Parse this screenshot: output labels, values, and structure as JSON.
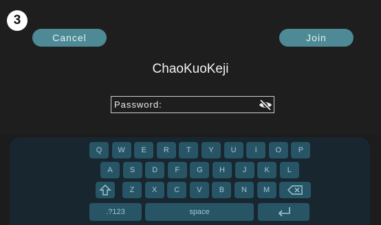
{
  "step": {
    "number": "3"
  },
  "buttons": {
    "cancel": "Cancel",
    "join": "Join"
  },
  "network": {
    "ssid": "ChaoKuoKeji"
  },
  "password": {
    "label": "Password:",
    "toggle_icon": "eye-slash-icon"
  },
  "keyboard": {
    "row1": [
      "Q",
      "W",
      "E",
      "R",
      "T",
      "Y",
      "U",
      "I",
      "O",
      "P"
    ],
    "row2": [
      "A",
      "S",
      "D",
      "F",
      "G",
      "H",
      "J",
      "K",
      "L"
    ],
    "row3": [
      "Z",
      "X",
      "C",
      "V",
      "B",
      "N",
      "M"
    ],
    "shift_icon": "shift-arrow-icon",
    "backspace_icon": "backspace-icon",
    "enter_icon": "enter-arrow-icon",
    "numbers_label": ".?123",
    "space_label": "space"
  },
  "colors": {
    "background": "#1e1e1e",
    "accent_button": "#4d8a96",
    "key": "#285565",
    "key_text": "#9ec9d7",
    "keyboard_panel": "#182630"
  }
}
